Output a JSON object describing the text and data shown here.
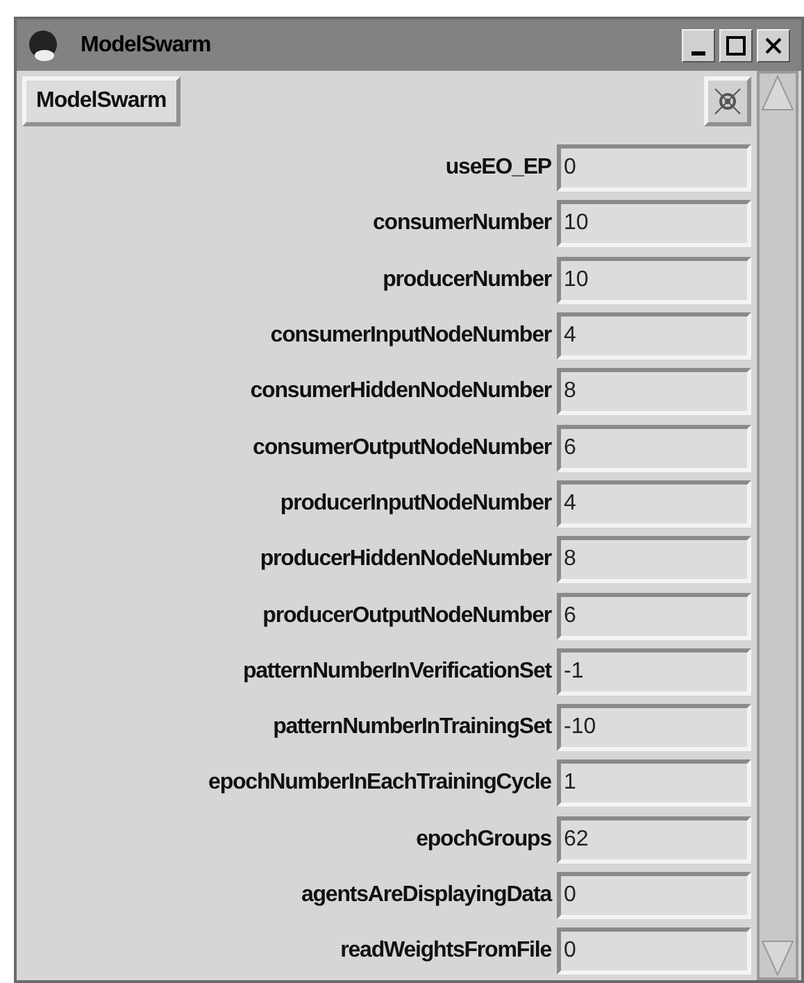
{
  "window": {
    "title": "ModelSwarm"
  },
  "header_button": "ModelSwarm",
  "fields": [
    {
      "label": "useEO_EP",
      "value": "0"
    },
    {
      "label": "consumerNumber",
      "value": "10"
    },
    {
      "label": "producerNumber",
      "value": "10"
    },
    {
      "label": "consumerInputNodeNumber",
      "value": "4"
    },
    {
      "label": "consumerHiddenNodeNumber",
      "value": "8"
    },
    {
      "label": "consumerOutputNodeNumber",
      "value": "6"
    },
    {
      "label": "producerInputNodeNumber",
      "value": "4"
    },
    {
      "label": "producerHiddenNodeNumber",
      "value": "8"
    },
    {
      "label": "producerOutputNodeNumber",
      "value": "6"
    },
    {
      "label": "patternNumberInVerificationSet",
      "value": "-1"
    },
    {
      "label": "patternNumberInTrainingSet",
      "value": "-10"
    },
    {
      "label": "epochNumberInEachTrainingCycle",
      "value": "1"
    },
    {
      "label": "epochGroups",
      "value": "62"
    },
    {
      "label": "agentsAreDisplayingData",
      "value": "0"
    },
    {
      "label": "readWeightsFromFile",
      "value": "0"
    }
  ]
}
